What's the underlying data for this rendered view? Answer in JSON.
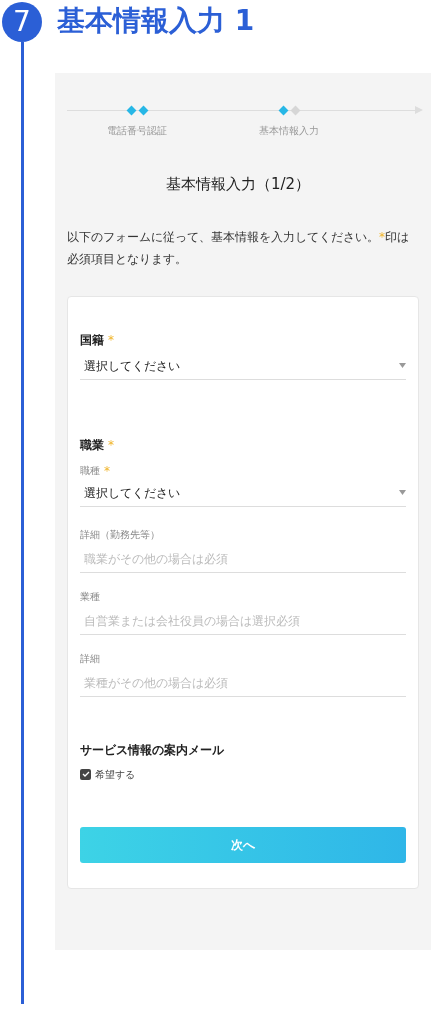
{
  "header": {
    "step_number": "7",
    "title": "基本情報入力 1"
  },
  "progress": {
    "steps": [
      {
        "label": "電話番号認証",
        "markers": [
          {
            "done": true
          },
          {
            "done": true
          }
        ]
      },
      {
        "label": "基本情報入力",
        "markers": [
          {
            "done": true
          },
          {
            "done": false
          }
        ]
      }
    ]
  },
  "page_title": "基本情報入力（1/2）",
  "intro": {
    "before": "以下のフォームに従って、基本情報を入力してください。",
    "mark": "*",
    "after": "印は必須項目となります。"
  },
  "form": {
    "sections": [
      {
        "label": "国籍",
        "required": true,
        "fields": [
          {
            "kind": "select",
            "value": "選択してください"
          }
        ]
      },
      {
        "label": "職業",
        "required": true,
        "fields": [
          {
            "kind": "select",
            "label": "職種",
            "required": true,
            "value": "選択してください"
          },
          {
            "kind": "text",
            "label": "詳細（勤務先等）",
            "required": false,
            "placeholder": "職業がその他の場合は必須"
          },
          {
            "kind": "text",
            "label": "業種",
            "required": false,
            "placeholder": "自営業または会社役員の場合は選択必須"
          },
          {
            "kind": "text",
            "label": "詳細",
            "required": false,
            "placeholder": "業種がその他の場合は必須"
          }
        ]
      },
      {
        "label": "サービス情報の案内メール",
        "required": false,
        "fields": [
          {
            "kind": "checkbox",
            "label": "希望する",
            "checked": true
          }
        ]
      }
    ],
    "submit": "次へ"
  }
}
